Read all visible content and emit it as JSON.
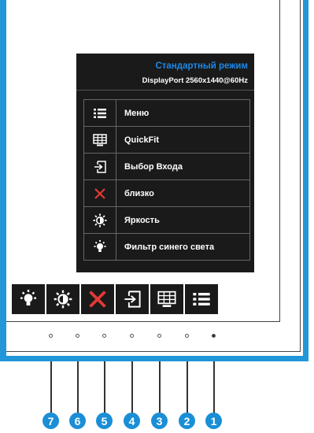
{
  "osd": {
    "mode_title": "Стандартный режим",
    "input_info": "DisplayPort  2560x1440@60Hz",
    "menu_items": [
      {
        "label": "Меню",
        "icon": "menu-list-icon"
      },
      {
        "label": "QuickFit",
        "icon": "quickfit-grid-icon"
      },
      {
        "label": "Выбор Входа",
        "icon": "input-select-icon"
      },
      {
        "label": "близко",
        "icon": "close-x-icon"
      },
      {
        "label": "Яркость",
        "icon": "brightness-sun-icon"
      },
      {
        "label": "Фильтр синего света",
        "icon": "blue-light-filter-icon"
      }
    ]
  },
  "keybar": {
    "keys": [
      "blue-light-filter-icon",
      "brightness-sun-icon",
      "close-x-icon",
      "input-select-icon",
      "quickfit-grid-icon",
      "menu-list-icon"
    ]
  },
  "callouts": [
    "7",
    "6",
    "5",
    "4",
    "3",
    "2",
    "1"
  ],
  "colors": {
    "accent_blue": "#1e88e5",
    "bezel_blue": "#2196d8",
    "close_red": "#e53935",
    "panel_black": "#1a1a1a"
  }
}
